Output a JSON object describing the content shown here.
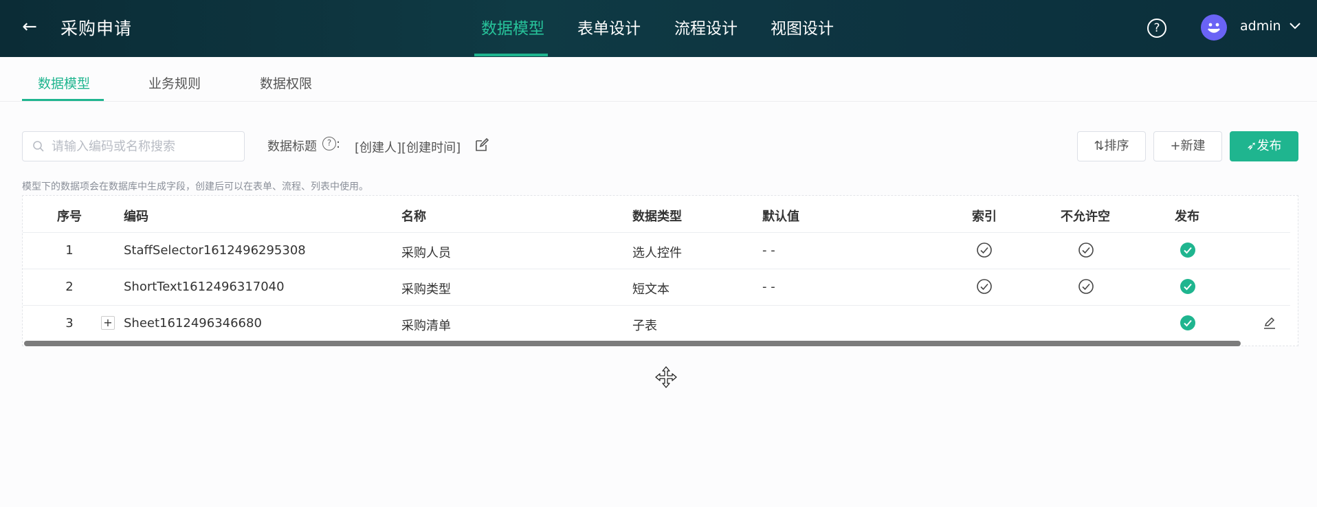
{
  "header": {
    "back_icon": "arrow-left-icon",
    "title": "采购申请",
    "tabs": [
      {
        "label": "数据模型",
        "active": true
      },
      {
        "label": "表单设计",
        "active": false
      },
      {
        "label": "流程设计",
        "active": false
      },
      {
        "label": "视图设计",
        "active": false
      }
    ],
    "help_icon": "question-circle-icon",
    "user": "admin",
    "accent_color": "#1fb58f"
  },
  "subtabs": [
    {
      "label": "数据模型",
      "active": true
    },
    {
      "label": "业务规则",
      "active": false
    },
    {
      "label": "数据权限",
      "active": false
    }
  ],
  "toolbar": {
    "search_placeholder": "请输入编码或名称搜索",
    "data_title_label": "数据标题",
    "data_title_colon": ":",
    "data_title_value": "[创建人][创建时间]",
    "sort_label": "⇅排序",
    "new_label": "+新建",
    "publish_label": "➶发布"
  },
  "hint": "模型下的数据项会在数据库中生成字段，创建后可以在表单、流程、列表中使用。",
  "table": {
    "columns": [
      "序号",
      "编码",
      "名称",
      "数据类型",
      "默认值",
      "索引",
      "不允许空",
      "发布"
    ],
    "rows": [
      {
        "index": "1",
        "code": "StaffSelector1612496295308",
        "name": "采购人员",
        "type": "选人控件",
        "default": "- -",
        "indexed": true,
        "required": true,
        "published": true,
        "expandable": false,
        "editable": false
      },
      {
        "index": "2",
        "code": "ShortText1612496317040",
        "name": "采购类型",
        "type": "短文本",
        "default": "- -",
        "indexed": true,
        "required": true,
        "published": true,
        "expandable": false,
        "editable": false
      },
      {
        "index": "3",
        "code": "Sheet1612496346680",
        "name": "采购清单",
        "type": "子表",
        "default": "",
        "indexed": false,
        "required": false,
        "published": true,
        "expandable": true,
        "editable": true
      }
    ],
    "expand_symbol": "+"
  }
}
